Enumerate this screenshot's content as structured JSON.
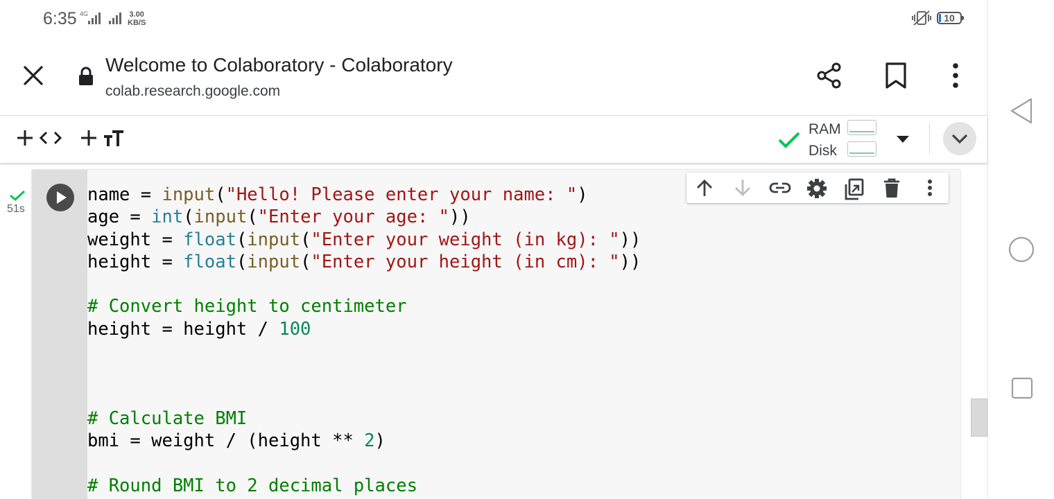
{
  "status_bar": {
    "time": "6:35",
    "network_type": "4G",
    "speed_value": "3.00",
    "speed_unit": "KB/S",
    "battery_level": "10",
    "icons": [
      "signal-4g-icon",
      "signal-icon",
      "vibrate-icon",
      "battery-icon"
    ]
  },
  "browser": {
    "page_title": "Welcome to Colaboratory - Colaboratory",
    "url": "colab.research.google.com",
    "icons": [
      "close-icon",
      "lock-icon",
      "share-icon",
      "bookmark-icon",
      "more-vert-icon"
    ]
  },
  "colab_toolbar": {
    "add_code_icons": [
      "plus-icon",
      "code-icon"
    ],
    "add_text_icons": [
      "plus-icon",
      "text-format-icon"
    ],
    "connected_icon": "check-icon",
    "ram_label": "RAM",
    "disk_label": "Disk",
    "dropdown_icon": "arrow-drop-down-icon",
    "collapse_icon": "chevron-down-icon",
    "accent_color": "#00c853"
  },
  "cell": {
    "exec_time": "51s",
    "status_icon": "check-icon",
    "run_icon": "play-icon",
    "toolbar_icons": [
      "arrow-up-icon",
      "arrow-down-icon",
      "link-icon",
      "settings-icon",
      "mirror-cell-icon",
      "delete-icon",
      "more-vert-icon"
    ],
    "code_lines": [
      [
        {
          "t": "name = ",
          "c": "plain"
        },
        {
          "t": "input",
          "c": "fn"
        },
        {
          "t": "(",
          "c": "plain"
        },
        {
          "t": "\"Hello! Please enter your name: \"",
          "c": "str"
        },
        {
          "t": ")",
          "c": "plain"
        }
      ],
      [
        {
          "t": "age = ",
          "c": "plain"
        },
        {
          "t": "int",
          "c": "bi"
        },
        {
          "t": "(",
          "c": "plain"
        },
        {
          "t": "input",
          "c": "fn"
        },
        {
          "t": "(",
          "c": "plain"
        },
        {
          "t": "\"Enter your age: \"",
          "c": "str"
        },
        {
          "t": "))",
          "c": "plain"
        }
      ],
      [
        {
          "t": "weight = ",
          "c": "plain"
        },
        {
          "t": "float",
          "c": "bi"
        },
        {
          "t": "(",
          "c": "plain"
        },
        {
          "t": "input",
          "c": "fn"
        },
        {
          "t": "(",
          "c": "plain"
        },
        {
          "t": "\"Enter your weight (in kg): \"",
          "c": "str"
        },
        {
          "t": "))",
          "c": "plain"
        }
      ],
      [
        {
          "t": "height = ",
          "c": "plain"
        },
        {
          "t": "float",
          "c": "bi"
        },
        {
          "t": "(",
          "c": "plain"
        },
        {
          "t": "input",
          "c": "fn"
        },
        {
          "t": "(",
          "c": "plain"
        },
        {
          "t": "\"Enter your height (in cm): \"",
          "c": "str"
        },
        {
          "t": "))",
          "c": "plain"
        }
      ],
      [],
      [
        {
          "t": "# Convert height to centimeter",
          "c": "cm"
        }
      ],
      [
        {
          "t": "height = height / ",
          "c": "plain"
        },
        {
          "t": "100",
          "c": "num"
        }
      ],
      [],
      [],
      [],
      [
        {
          "t": "# Calculate BMI",
          "c": "cm"
        }
      ],
      [
        {
          "t": "bmi = weight / (height ** ",
          "c": "plain"
        },
        {
          "t": "2",
          "c": "num"
        },
        {
          "t": ")",
          "c": "plain"
        }
      ],
      [],
      [
        {
          "t": "# Round BMI to 2 decimal places",
          "c": "cm"
        }
      ]
    ]
  },
  "nav_bar": {
    "icons": [
      "back-icon",
      "home-icon",
      "recents-icon"
    ]
  }
}
